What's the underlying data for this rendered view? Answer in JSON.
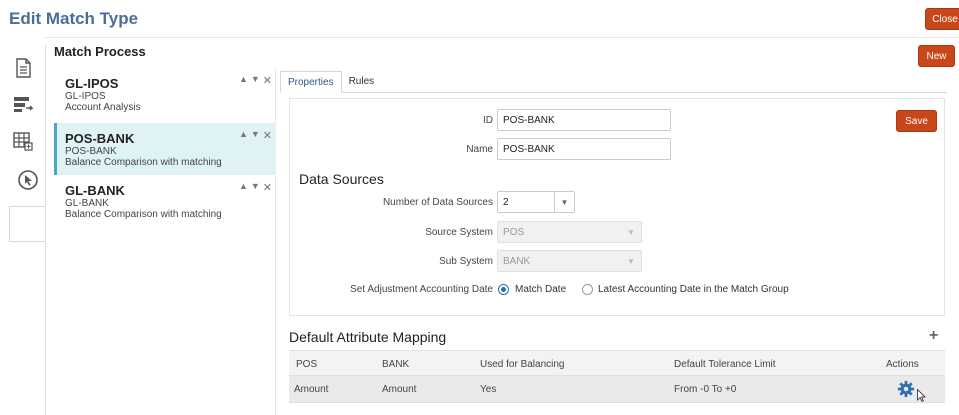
{
  "page": {
    "title": "Edit Match Type",
    "close_label": "Close"
  },
  "match_process": {
    "title": "Match Process",
    "new_label": "New",
    "items": [
      {
        "name": "GL-IPOS",
        "line1": "GL-IPOS",
        "line2": "Account Analysis"
      },
      {
        "name": "POS-BANK",
        "line1": "POS-BANK",
        "line2": "Balance Comparison with matching"
      },
      {
        "name": "GL-BANK",
        "line1": "GL-BANK",
        "line2": "Balance Comparison with matching"
      }
    ]
  },
  "tabs": [
    {
      "label": "Properties"
    },
    {
      "label": "Rules"
    }
  ],
  "properties": {
    "save_label": "Save",
    "id_label": "ID",
    "id_value": "POS-BANK",
    "name_label": "Name",
    "name_value": "POS-BANK",
    "data_sources_title": "Data Sources",
    "num_sources_label": "Number of Data Sources",
    "num_sources_value": "2",
    "source_system_label": "Source System",
    "source_system_value": "POS",
    "sub_system_label": "Sub System",
    "sub_system_value": "BANK",
    "adj_date_label": "Set Adjustment Accounting Date",
    "adj_option_1": "Match Date",
    "adj_option_2": "Latest Accounting Date in the Match Group"
  },
  "mapping": {
    "title": "Default Attribute Mapping",
    "headers": [
      "POS",
      "BANK",
      "Used for Balancing",
      "Default Tolerance Limit",
      "Actions"
    ],
    "rows": [
      {
        "pos": "Amount",
        "bank": "Amount",
        "balancing": "Yes",
        "tolerance": "From -0 To +0"
      }
    ]
  },
  "colors": {
    "accent_button": "#c9471a",
    "title_blue": "#4a6f9a",
    "selected_bg": "#dff3f5",
    "gear_blue": "#2f6fb5"
  }
}
